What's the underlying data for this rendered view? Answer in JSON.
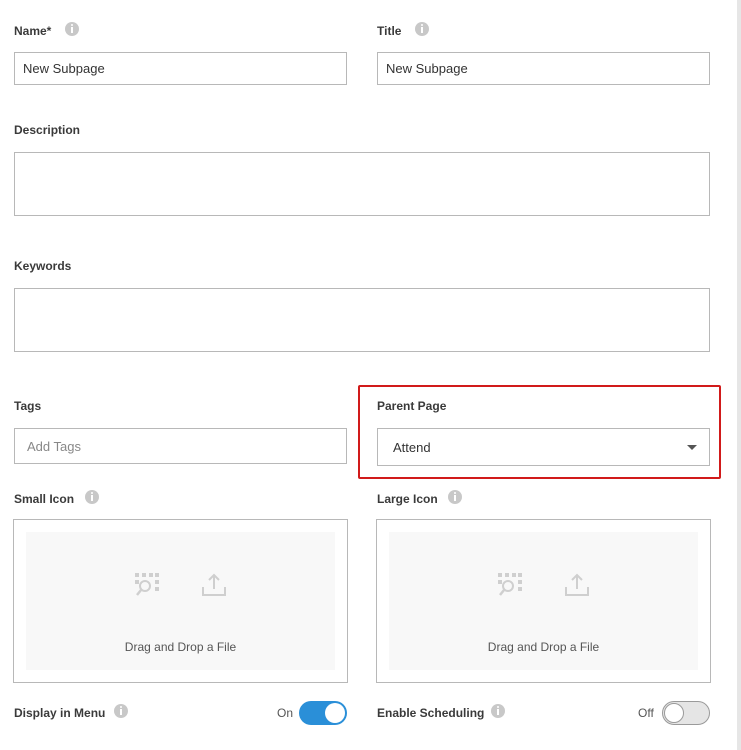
{
  "form": {
    "name": {
      "label": "Name*",
      "value": "New Subpage"
    },
    "title": {
      "label": "Title",
      "value": "New Subpage"
    },
    "description": {
      "label": "Description",
      "value": ""
    },
    "keywords": {
      "label": "Keywords",
      "value": ""
    },
    "tags": {
      "label": "Tags",
      "placeholder": "Add Tags"
    },
    "parent_page": {
      "label": "Parent Page",
      "selected": "Attend"
    },
    "small_icon": {
      "label": "Small Icon",
      "dropzone_text": "Drag and Drop a File"
    },
    "large_icon": {
      "label": "Large Icon",
      "dropzone_text": "Drag and Drop a File"
    },
    "display_in_menu": {
      "label": "Display in Menu",
      "state_label": "On",
      "state": true
    },
    "enable_scheduling": {
      "label": "Enable Scheduling",
      "state_label": "Off",
      "state": false
    }
  },
  "colors": {
    "highlight": "#d11a1a",
    "toggle_on": "#2a8fd8",
    "border": "#b8b8b8"
  }
}
